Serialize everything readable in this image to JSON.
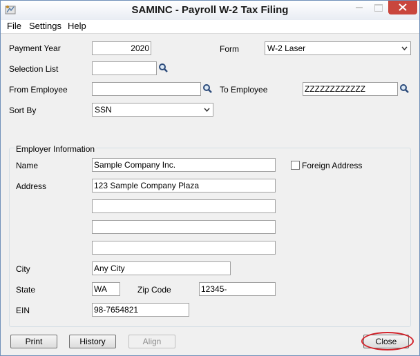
{
  "window": {
    "title": "SAMINC - Payroll W-2 Tax Filing",
    "icon": "app-icon"
  },
  "menu": [
    "File",
    "Settings",
    "Help"
  ],
  "fields": {
    "payment_year": {
      "label": "Payment Year",
      "value": "2020"
    },
    "form": {
      "label": "Form",
      "value": "W-2 Laser"
    },
    "selection_list": {
      "label": "Selection List",
      "value": ""
    },
    "from_employee": {
      "label": "From Employee",
      "value": ""
    },
    "to_employee": {
      "label": "To Employee",
      "value": "ZZZZZZZZZZZZ"
    },
    "sort_by": {
      "label": "Sort By",
      "value": "SSN"
    }
  },
  "employer": {
    "group_label": "Employer Information",
    "name_label": "Name",
    "name": "Sample Company Inc.",
    "foreign_address_label": "Foreign Address",
    "foreign_address_checked": false,
    "address_label": "Address",
    "address": [
      "123 Sample Company Plaza",
      "",
      "",
      ""
    ],
    "city_label": "City",
    "city": "Any City",
    "state_label": "State",
    "state": "WA",
    "zip_label": "Zip Code",
    "zip": "12345-",
    "ein_label": "EIN",
    "ein": "98-7654821"
  },
  "buttons": {
    "print": "Print",
    "history": "History",
    "align": "Align",
    "close": "Close"
  },
  "colors": {
    "window_bg": "#f0f0f0",
    "close_button": "#c9463d",
    "highlight_circle": "#d3222a"
  }
}
